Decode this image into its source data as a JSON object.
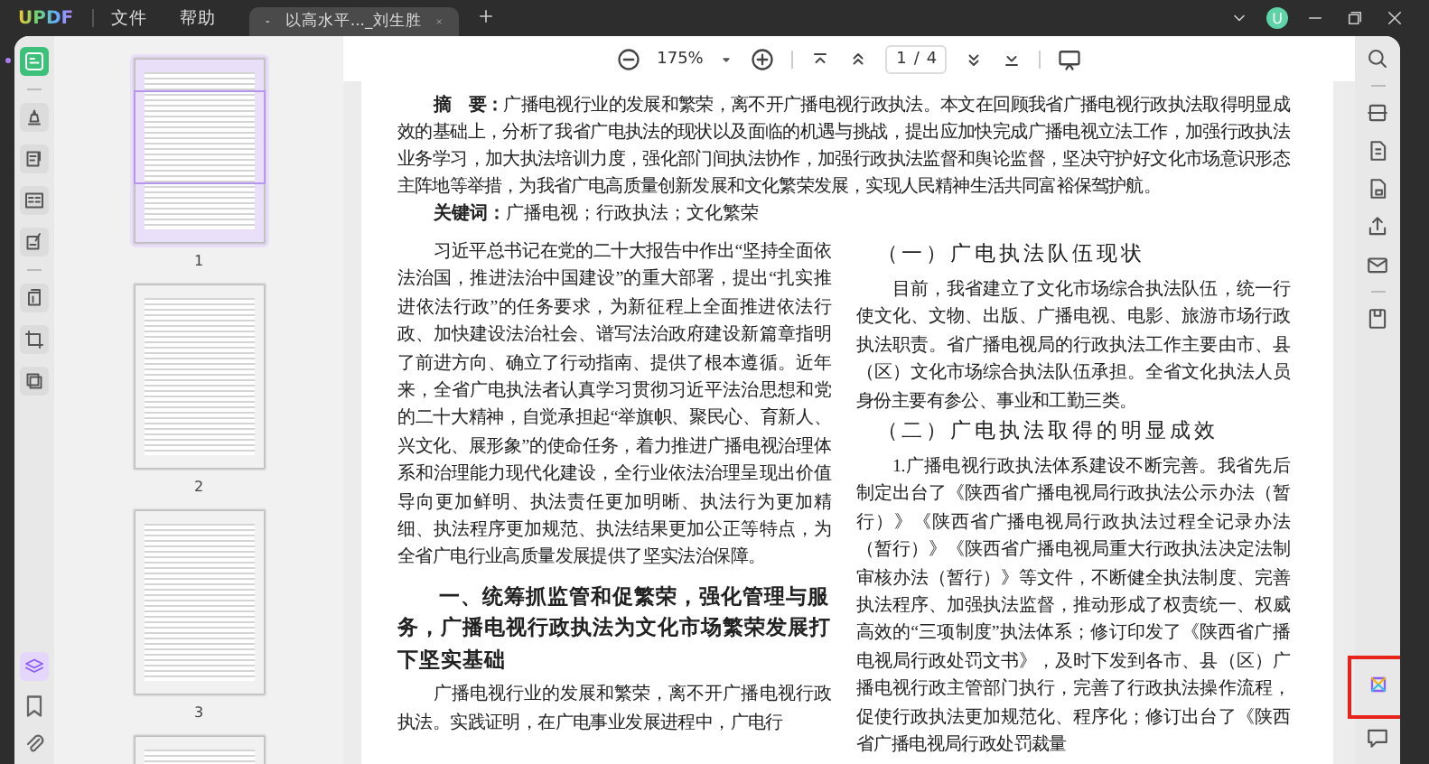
{
  "title_bar": {
    "logo": "UPDF",
    "menus": [
      "文件",
      "帮助"
    ],
    "tab": {
      "title": "以高水平..._刘生胜"
    },
    "avatar": "U"
  },
  "toolbar": {
    "zoom": "175%",
    "page": "1",
    "page_separator": "/",
    "page_total": "4"
  },
  "left_tools": [
    {
      "selected": true
    },
    {
      "selected": false
    },
    {
      "selected": false
    },
    {
      "selected": false
    },
    {
      "selected": false
    },
    {
      "selected": false
    },
    {
      "selected": false
    },
    {
      "selected": false
    }
  ],
  "thumbnails": [
    {
      "label": "1",
      "selected": true
    },
    {
      "label": "2",
      "selected": false
    },
    {
      "label": "3",
      "selected": false
    },
    {
      "selected": false
    }
  ],
  "document": {
    "abstract": "**摘　要：**广播电视行业的发展和繁荣，离不开广播电视行政执法。本文在回顾我省广播电视行政执法取得明显成效的基础上，分析了我省广电执法的现状以及面临的机遇与挑战，提出应加快完成广播电视立法工作，加强行政执法业务学习，加大执法培训力度，强化部门间执法协作，加强行政执法监督和舆论监督，坚决守护好文化市场意识形态主阵地等举措，为我省广电高质量创新发展和文化繁荣发展，实现人民精神生活共同富裕保驾护航。",
    "keywords": "**关键词：**广播电视；行政执法；文化繁荣",
    "left_column": [
      {
        "kind": "paragraph",
        "text": "习近平总书记在党的二十大报告中作出“坚持全面依法治国，推进法治中国建设”的重大部署，提出“扎实推进依法行政”的任务要求，为新征程上全面推进依法行政、加快建设法治社会、谱写法治政府建设新篇章指明了前进方向、确立了行动指南、提供了根本遵循。近年来，全省广电执法者认真学习贯彻习近平法治思想和党的二十大精神，自觉承担起“举旗帜、聚民心、育新人、兴文化、展形象”的使命任务，着力推进广播电视治理体系和治理能力现代化建设，全行业依法治理呈现出价值导向更加鲜明、执法责任更加明晰、执法行为更加精细、执法程序更加规范、执法结果更加公正等特点，为全省广电行业高质量发展提供了坚实法治保障。"
      },
      {
        "kind": "heading",
        "text": "一、统筹抓监管和促繁荣，强化管理与服务，广播电视行政执法为文化市场繁荣发展打下坚实基础"
      },
      {
        "kind": "paragraph",
        "text": "广播电视行业的发展和繁荣，离不开广播电视行政执法。实践证明，在广电事业发展进程中，广电行"
      }
    ],
    "right_column": [
      {
        "kind": "subheading",
        "text": "（一）广电执法队伍现状"
      },
      {
        "kind": "paragraph",
        "text": "目前，我省建立了文化市场综合执法队伍，统一行使文化、文物、出版、广播电视、电影、旅游市场行政执法职责。省广播电视局的行政执法工作主要由市、县（区）文化市场综合执法队伍承担。全省文化执法人员身份主要有参公、事业和工勤三类。"
      },
      {
        "kind": "subheading",
        "text": "（二）广电执法取得的明显成效"
      },
      {
        "kind": "paragraph",
        "text": "1.广播电视行政执法体系建设不断完善。我省先后制定出台了《陕西省广播电视局行政执法公示办法（暂行）》《陕西省广播电视局行政执法过程全记录办法（暂行）》《陕西省广播电视局重大行政执法决定法制审核办法（暂行）》等文件，不断健全执法制度、完善执法程序、加强执法监督，推动形成了权责统一、权威高效的“三项制度”执法体系；修订印发了《陕西省广播电视局行政处罚文书》，及时下发到各市、县（区）广播电视行政主管部门执行，完善了行政执法操作流程，促使行政执法更加规范化、程序化；修订出台了《陕西省广播电视局行政处罚裁量"
      }
    ]
  }
}
